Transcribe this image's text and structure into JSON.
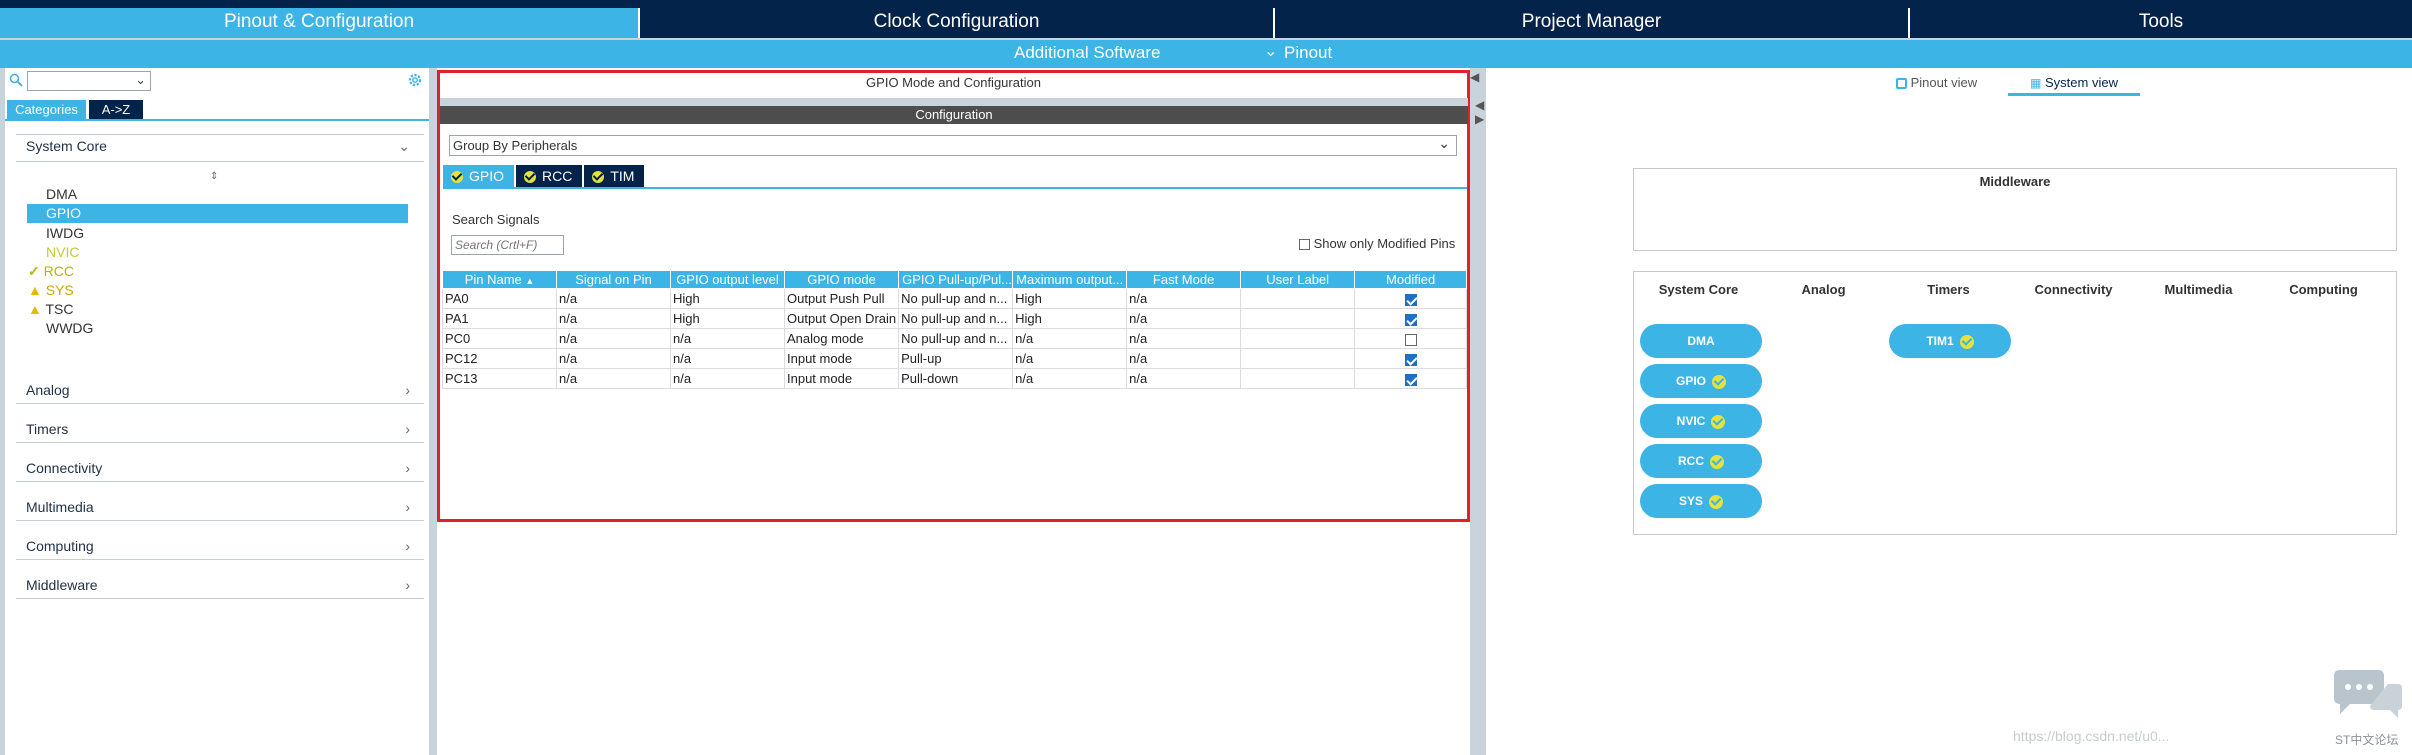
{
  "topnav": {
    "tabs": [
      {
        "label": "Pinout & Configuration"
      },
      {
        "label": "Clock Configuration"
      },
      {
        "label": "Project Manager"
      },
      {
        "label": "Tools"
      }
    ],
    "sub_items": [
      {
        "label": "Additional Software"
      },
      {
        "label": "Pinout"
      }
    ]
  },
  "sidebar": {
    "search_placeholder": "",
    "tabs": [
      {
        "label": "Categories"
      },
      {
        "label": "A->Z"
      }
    ],
    "system_core_label": "System Core",
    "items": [
      {
        "label": "DMA",
        "status": ""
      },
      {
        "label": "GPIO",
        "status": "selected"
      },
      {
        "label": "IWDG",
        "status": ""
      },
      {
        "label": "NVIC",
        "status": "info"
      },
      {
        "label": "RCC",
        "status": "ok"
      },
      {
        "label": "SYS",
        "status": "warn"
      },
      {
        "label": "TSC",
        "status": "warn"
      },
      {
        "label": "WWDG",
        "status": ""
      }
    ],
    "categories": [
      {
        "label": "Analog"
      },
      {
        "label": "Timers"
      },
      {
        "label": "Connectivity"
      },
      {
        "label": "Multimedia"
      },
      {
        "label": "Computing"
      },
      {
        "label": "Middleware"
      }
    ]
  },
  "center": {
    "title": "GPIO Mode and Configuration",
    "config_label": "Configuration",
    "group_select": "Group By Peripherals",
    "peripheral_tabs": [
      {
        "label": "GPIO"
      },
      {
        "label": "RCC"
      },
      {
        "label": "TIM"
      }
    ],
    "search_label": "Search Signals",
    "search_placeholder": "Search (Crtl+F)",
    "show_modified_label": "Show only Modified Pins",
    "columns": [
      "Pin Name",
      "Signal on Pin",
      "GPIO output level",
      "GPIO mode",
      "GPIO Pull-up/Pul...",
      "Maximum output...",
      "Fast Mode",
      "User Label",
      "Modified"
    ],
    "rows": [
      {
        "pin": "PA0",
        "signal": "n/a",
        "level": "High",
        "mode": "Output Push Pull",
        "pull": "No pull-up and n...",
        "speed": "High",
        "fast": "n/a",
        "label": "",
        "modified": true
      },
      {
        "pin": "PA1",
        "signal": "n/a",
        "level": "High",
        "mode": "Output Open Drain",
        "pull": "No pull-up and n...",
        "speed": "High",
        "fast": "n/a",
        "label": "",
        "modified": true
      },
      {
        "pin": "PC0",
        "signal": "n/a",
        "level": "n/a",
        "mode": "Analog mode",
        "pull": "No pull-up and n...",
        "speed": "n/a",
        "fast": "n/a",
        "label": "",
        "modified": false
      },
      {
        "pin": "PC12",
        "signal": "n/a",
        "level": "n/a",
        "mode": "Input mode",
        "pull": "Pull-up",
        "speed": "n/a",
        "fast": "n/a",
        "label": "",
        "modified": true
      },
      {
        "pin": "PC13",
        "signal": "n/a",
        "level": "n/a",
        "mode": "Input mode",
        "pull": "Pull-down",
        "speed": "n/a",
        "fast": "n/a",
        "label": "",
        "modified": true
      }
    ]
  },
  "right": {
    "view_tabs": [
      {
        "label": "Pinout view"
      },
      {
        "label": "System view"
      }
    ],
    "middleware_title": "Middleware",
    "system_columns": [
      "System Core",
      "Analog",
      "Timers",
      "Connectivity",
      "Multimedia",
      "Computing"
    ],
    "system_core_pills": [
      {
        "label": "DMA"
      },
      {
        "label": "GPIO"
      },
      {
        "label": "NVIC"
      },
      {
        "label": "RCC"
      },
      {
        "label": "SYS"
      }
    ],
    "timer_pills": [
      {
        "label": "TIM1"
      }
    ]
  },
  "watermark": {
    "url": "https://blog.csdn.net/u0...",
    "brand": "ST中文论坛"
  },
  "colors": {
    "nav_dark": "#03234b",
    "accent": "#3cb4e6",
    "highlight_border": "#e0212b",
    "selected": "#3cb4e6",
    "status_warn": "#e6b800",
    "status_ok": "#c7c800"
  }
}
